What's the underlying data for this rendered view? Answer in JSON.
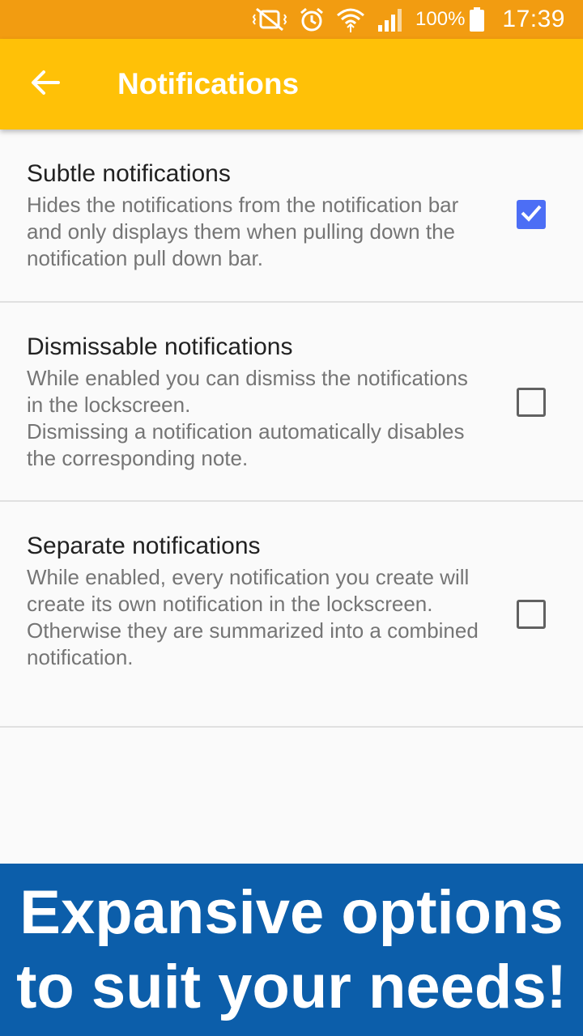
{
  "status_bar": {
    "battery": "100%",
    "time": "17:39",
    "icons": [
      "mute-vibrate-icon",
      "alarm-icon",
      "wifi-icon",
      "signal-icon",
      "battery-icon"
    ]
  },
  "app_bar": {
    "title": "Notifications",
    "back_icon": "arrow-back-icon"
  },
  "settings": [
    {
      "title": "Subtle notifications",
      "summary": "Hides the notifications from the notification bar and only displays them when pulling down the notification pull down bar.",
      "checked": true
    },
    {
      "title": "Dismissable notifications",
      "summary": "While enabled you can dismiss the notifications in the lockscreen.\nDismissing a notification automatically disables the corresponding note.",
      "checked": false
    },
    {
      "title": "Separate notifications",
      "summary": "While enabled, every notification you create will create its own notification in the lockscreen.\nOtherwise they are summarized into a combined notification.",
      "checked": false
    }
  ],
  "promo": {
    "line1": "Expansive options",
    "line2": "to suit your needs!"
  },
  "colors": {
    "status_bar": "#f29c11",
    "app_bar": "#ffc107",
    "checkbox_checked": "#4c6ef5",
    "promo_background": "#0c5eaa"
  }
}
